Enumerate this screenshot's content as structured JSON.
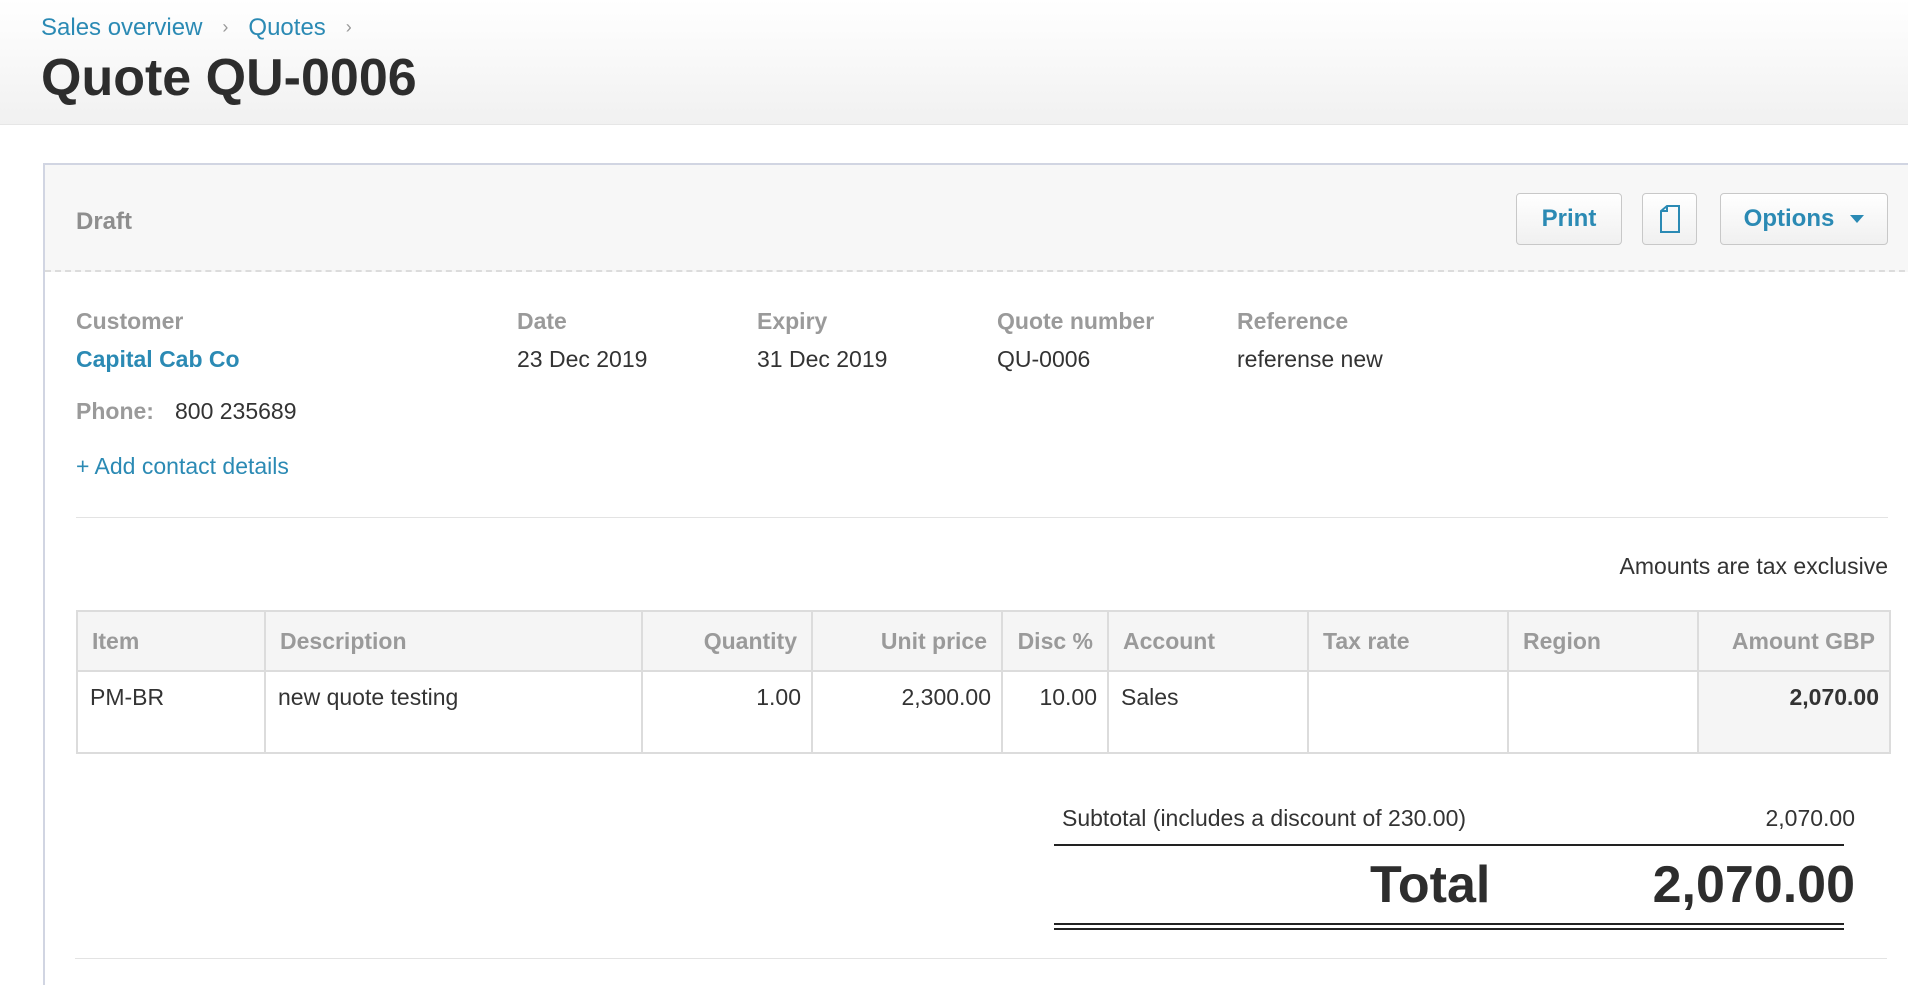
{
  "breadcrumb": {
    "item1": "Sales overview",
    "item2": "Quotes"
  },
  "page_title": "Quote QU-0006",
  "status": "Draft",
  "toolbar": {
    "print_label": "Print",
    "options_label": "Options"
  },
  "fields": {
    "customer_label": "Customer",
    "customer_name": "Capital Cab Co",
    "date_label": "Date",
    "date_value": "23 Dec 2019",
    "expiry_label": "Expiry",
    "expiry_value": "31 Dec 2019",
    "quote_number_label": "Quote number",
    "quote_number_value": "QU-0006",
    "reference_label": "Reference",
    "reference_value": "referense new",
    "phone_label": "Phone:",
    "phone_value": "800 235689",
    "add_contact": "+ Add contact details"
  },
  "tax_note": "Amounts are tax exclusive",
  "table": {
    "headers": {
      "item": "Item",
      "description": "Description",
      "quantity": "Quantity",
      "unit_price": "Unit price",
      "disc": "Disc %",
      "account": "Account",
      "tax_rate": "Tax rate",
      "region": "Region",
      "amount": "Amount GBP"
    },
    "rows": [
      {
        "item": "PM-BR",
        "description": "new quote testing",
        "quantity": "1.00",
        "unit_price": "2,300.00",
        "disc": "10.00",
        "account": "Sales",
        "tax_rate": "",
        "region": "",
        "amount": "2,070.00"
      }
    ]
  },
  "totals": {
    "subtotal_label": "Subtotal (includes a discount of 230.00)",
    "subtotal_value": "2,070.00",
    "total_label": "Total",
    "total_value": "2,070.00"
  },
  "icons": {
    "copy": "copy-icon",
    "chevron": "chevron-right-icon",
    "dropdown": "caret-down-icon"
  },
  "colors": {
    "link": "#2b8ab4",
    "label": "#9a9a9a",
    "text": "#333333"
  }
}
